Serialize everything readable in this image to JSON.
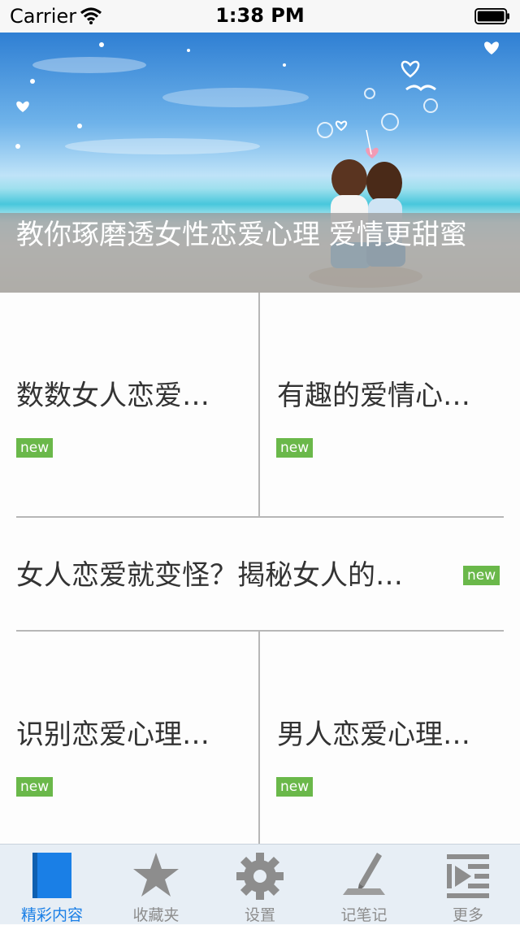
{
  "status_bar": {
    "carrier": "Carrier",
    "time": "1:38 PM"
  },
  "banner": {
    "title": "教你琢磨透女性恋爱心理 爱情更甜蜜"
  },
  "articles": [
    {
      "title": "数数女人恋爱…",
      "badge": "new"
    },
    {
      "title": "有趣的爱情心…",
      "badge": "new"
    },
    {
      "title": "女人恋爱就变怪？揭秘女人的…",
      "badge": "new"
    },
    {
      "title": "识别恋爱心理…",
      "badge": "new"
    },
    {
      "title": "男人恋爱心理…",
      "badge": "new"
    }
  ],
  "tab_bar": {
    "tabs": [
      {
        "label": "精彩内容",
        "icon": "book-icon",
        "active": true
      },
      {
        "label": "收藏夹",
        "icon": "star-icon",
        "active": false
      },
      {
        "label": "设置",
        "icon": "gear-icon",
        "active": false
      },
      {
        "label": "记笔记",
        "icon": "pen-icon",
        "active": false
      },
      {
        "label": "更多",
        "icon": "list-indent-icon",
        "active": false
      }
    ]
  },
  "colors": {
    "accent": "#1a7fe6",
    "badge": "#6ab84a",
    "divider": "#b7b7b7"
  }
}
